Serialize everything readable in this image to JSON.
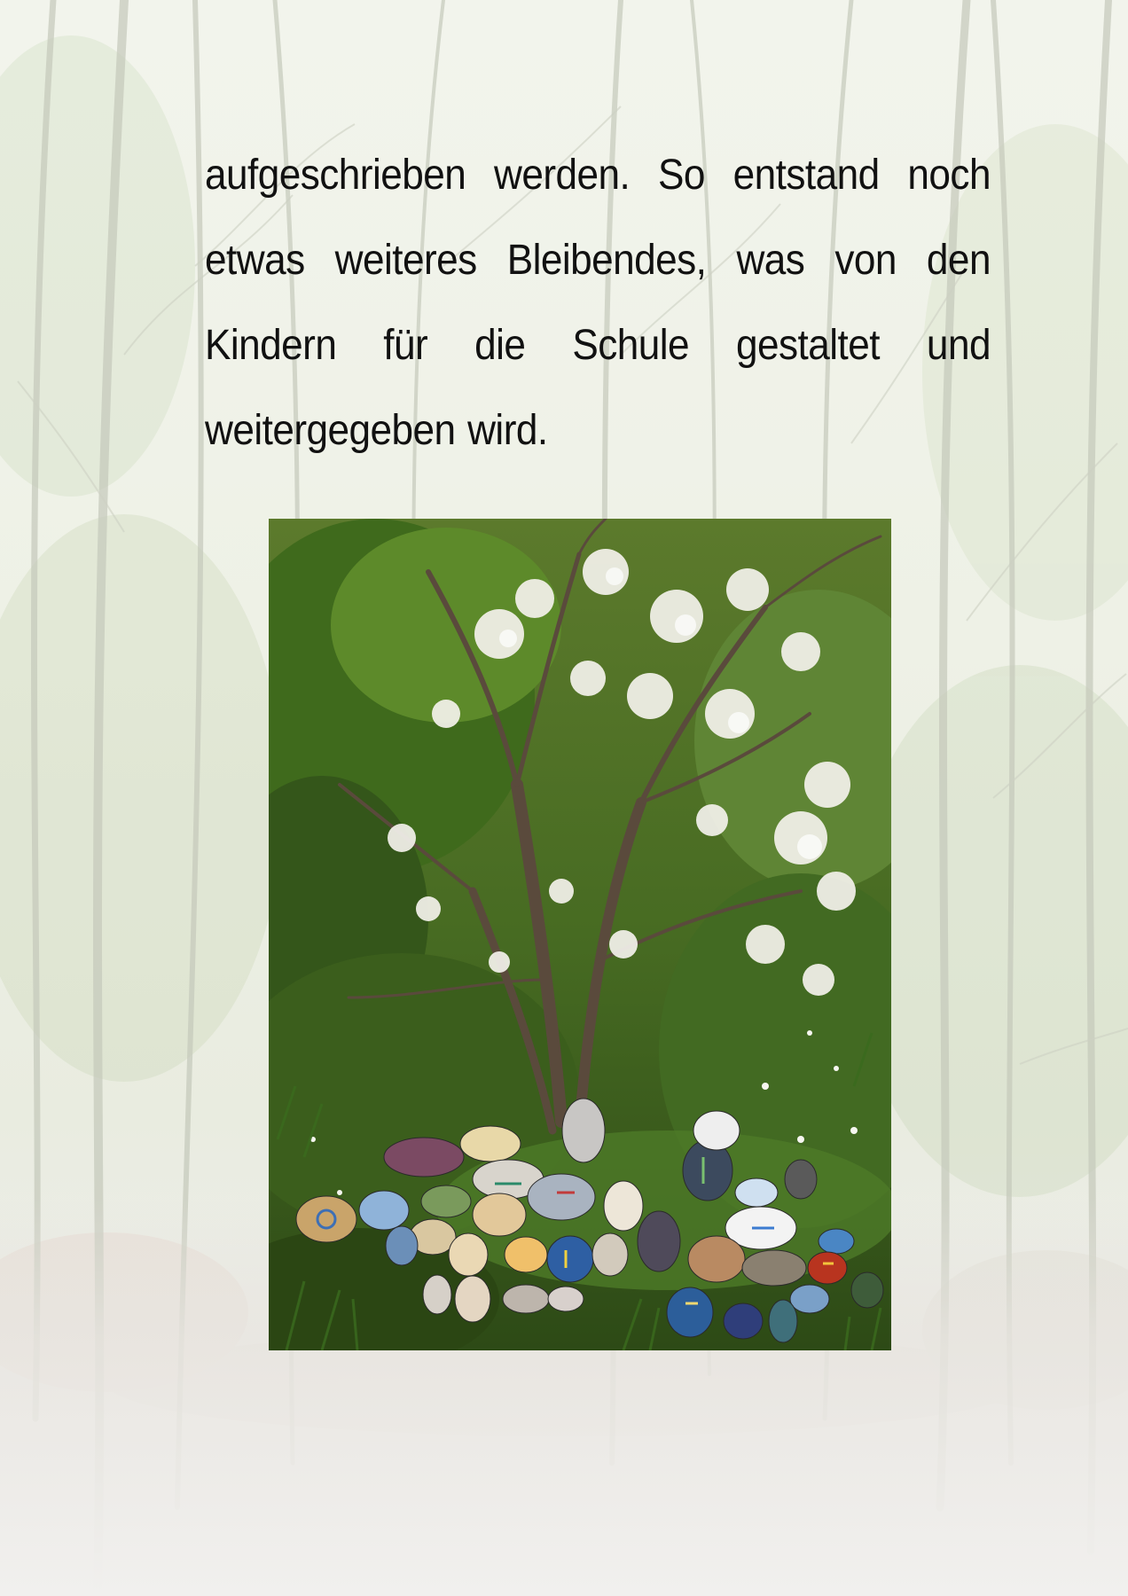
{
  "page": {
    "paragraph": "aufgeschrieben werden. So entstand noch etwas weiteres Bleibendes, was von den Kindern für die Schule gestaltet und weitergegeben wird."
  },
  "colors": {
    "text": "#111111",
    "page_background": "#eef1e6"
  },
  "icons": {
    "background": "forest-background",
    "photo": "tree-with-painted-stones-photo"
  }
}
